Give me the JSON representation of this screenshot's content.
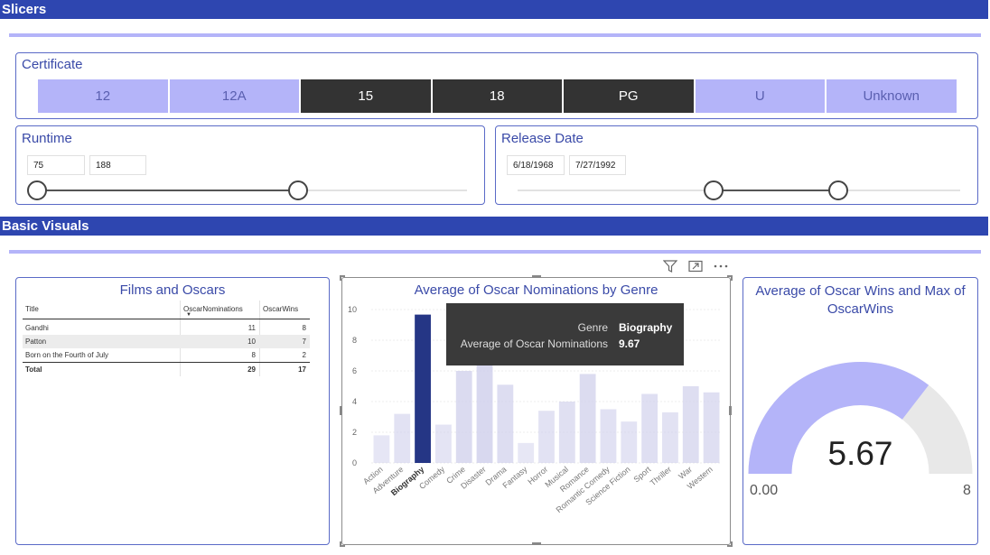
{
  "sections": {
    "slicers": "Slicers",
    "basic_visuals": "Basic Visuals"
  },
  "certificate": {
    "title": "Certificate",
    "options": [
      {
        "label": "12",
        "selected": false
      },
      {
        "label": "12A",
        "selected": false
      },
      {
        "label": "15",
        "selected": true
      },
      {
        "label": "18",
        "selected": true
      },
      {
        "label": "PG",
        "selected": true
      },
      {
        "label": "U",
        "selected": false
      },
      {
        "label": "Unknown",
        "selected": false
      }
    ]
  },
  "runtime": {
    "title": "Runtime",
    "min": "75",
    "max": "188"
  },
  "release_date": {
    "title": "Release Date",
    "start": "6/18/1968",
    "end": "7/27/1992"
  },
  "films_table": {
    "title": "Films and Oscars",
    "columns": [
      "Title",
      "OscarNominations",
      "OscarWins"
    ],
    "rows": [
      [
        "Gandhi",
        "11",
        "8"
      ],
      [
        "Patton",
        "10",
        "7"
      ],
      [
        "Born on the Fourth of July",
        "8",
        "2"
      ]
    ],
    "total": [
      "Total",
      "29",
      "17"
    ]
  },
  "chart_data": {
    "type": "bar",
    "title": "Average of Oscar Nominations by Genre",
    "categories": [
      "Action",
      "Adventure",
      "Biography",
      "Comedy",
      "Crime",
      "Disaster",
      "Drama",
      "Fantasy",
      "Horror",
      "Musical",
      "Romance",
      "Romantic Comedy",
      "Science Fiction",
      "Sport",
      "Thriller",
      "War",
      "Western"
    ],
    "values": [
      1.8,
      3.2,
      9.67,
      2.5,
      6.0,
      7.2,
      5.1,
      1.3,
      3.4,
      4.0,
      5.8,
      3.5,
      2.7,
      4.5,
      3.3,
      5.0,
      4.6
    ],
    "highlighted": "Biography",
    "yticks": [
      "0",
      "2",
      "4",
      "6",
      "8",
      "10"
    ],
    "ylim": [
      0,
      10
    ],
    "colors": {
      "highlight": "#253685",
      "dim": "#d1d1ec"
    }
  },
  "tooltip": {
    "genre_label": "Genre",
    "genre_value": "Biography",
    "metric_label": "Average of Oscar Nominations",
    "metric_value": "9.67"
  },
  "gauge": {
    "title": "Average of Oscar Wins and Max of OscarWins",
    "value": 5.67,
    "value_label": "5.67",
    "min_label": "0.00",
    "max_label": "8",
    "max": 8,
    "colors": {
      "fill": "#b4b4f9",
      "track": "#e8e8e8"
    }
  },
  "icons": [
    "filter-icon",
    "focus-mode-icon",
    "more-options-icon"
  ]
}
